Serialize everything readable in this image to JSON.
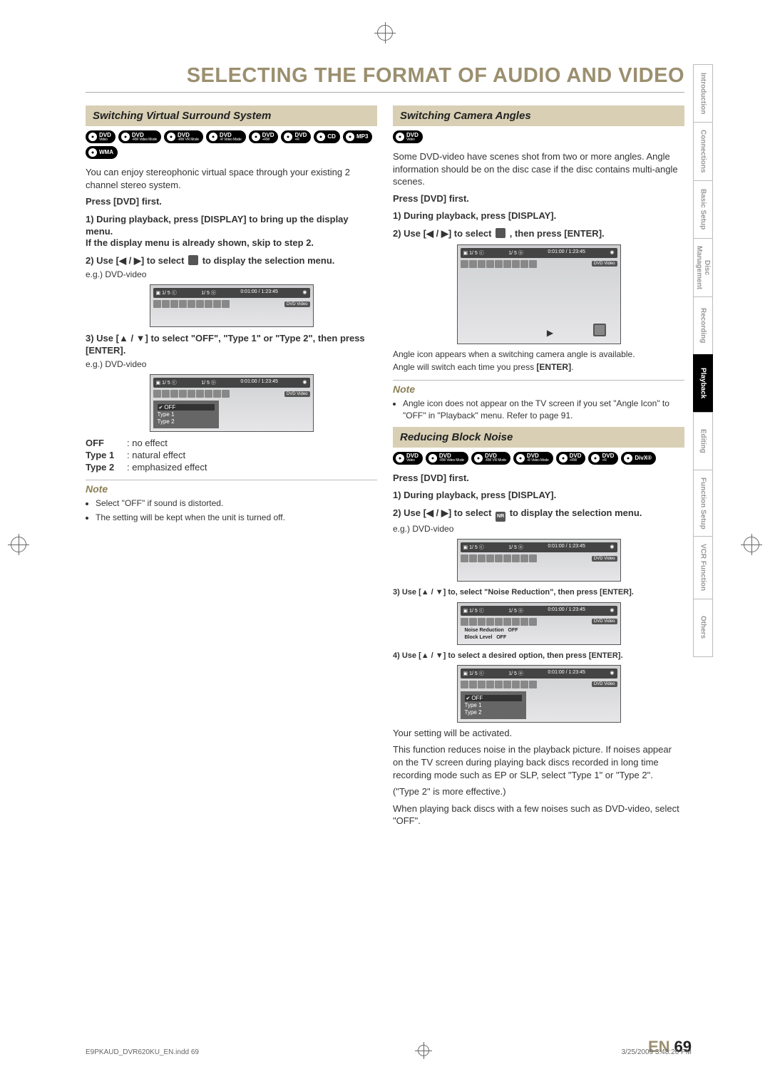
{
  "title": "SELECTING THE FORMAT OF AUDIO AND VIDEO",
  "page_label": "EN",
  "page_number": "69",
  "footer_file": "E9PKAUD_DVR620KU_EN.indd   69",
  "footer_time": "3/25/2009   3:48:26 PM",
  "tabs": [
    "Introduction",
    "Connections",
    "Basic Setup",
    "Disc\nManagement",
    "Recording",
    "Playback",
    "Editing",
    "Function Setup",
    "VCR Function",
    "Others"
  ],
  "active_tab": "Playback",
  "osd_common": {
    "top_left": "1/  5",
    "top_mid": "1/  5",
    "time": "0:01:00 / 1:23:45",
    "badge": "DVD  Video"
  },
  "left": {
    "section": "Switching Virtual Surround System",
    "discs": [
      {
        "t": "DVD",
        "s": "Video"
      },
      {
        "t": "DVD",
        "s": "-RW Video Mode"
      },
      {
        "t": "DVD",
        "s": "-RW VR Mode"
      },
      {
        "t": "DVD",
        "s": "-R Video Mode"
      },
      {
        "t": "DVD",
        "s": "+RW"
      },
      {
        "t": "DVD",
        "s": "+R"
      },
      {
        "t": "CD",
        "s": ""
      },
      {
        "t": "MP3",
        "s": ""
      },
      {
        "t": "WMA",
        "s": ""
      }
    ],
    "intro": "You can enjoy stereophonic virtual space through your existing 2 channel stereo system.",
    "press": "Press [DVD] first.",
    "s1": "1) During playback, press [DISPLAY] to bring up the display menu.",
    "s1b": "If the display menu is already shown, skip to step 2.",
    "s2a": "2) Use [",
    "s2b": " / ",
    "s2c": "] to select ",
    "s2d": " to display the selection menu.",
    "eg": "e.g.) DVD-video",
    "s3": "3) Use [▲ / ▼] to select \"OFF\", \"Type 1\" or \"Type 2\", then press [ENTER].",
    "menu_items": [
      "OFF",
      "Type 1",
      "Type 2"
    ],
    "defs": [
      {
        "k": "OFF",
        "v": ": no effect"
      },
      {
        "k": "Type 1",
        "v": ": natural effect"
      },
      {
        "k": "Type 2",
        "v": ": emphasized effect"
      }
    ],
    "note_title": "Note",
    "notes": [
      "Select \"OFF\" if sound is distorted.",
      "The setting will be kept when the unit is turned off."
    ]
  },
  "right": {
    "sec_angle": "Switching Camera Angles",
    "discs_angle": [
      {
        "t": "DVD",
        "s": "Video"
      }
    ],
    "angle_intro": "Some DVD-video have scenes shot from two or more angles. Angle information should be on the disc case if the disc contains multi-angle scenes.",
    "press": "Press [DVD] first.",
    "a1": "1) During playback, press [DISPLAY].",
    "a2a": "2) Use [",
    "a2b": " / ",
    "a2c": "] to select ",
    "a2d": " , then press [ENTER].",
    "angle_cap1": "Angle icon appears when a switching camera angle is available.",
    "angle_cap2_a": "Angle will switch each time you press ",
    "angle_cap2_b": "[ENTER]",
    "angle_cap2_c": ".",
    "note_title": "Note",
    "angle_notes": [
      "Angle icon does not appear on the TV screen if you set \"Angle Icon\" to \"OFF\" in \"Playback\" menu. Refer to page 91."
    ],
    "sec_noise": "Reducing Block Noise",
    "discs_noise": [
      {
        "t": "DVD",
        "s": "Video"
      },
      {
        "t": "DVD",
        "s": "-RW Video Mode"
      },
      {
        "t": "DVD",
        "s": "-RW VR Mode"
      },
      {
        "t": "DVD",
        "s": "-R Video Mode"
      },
      {
        "t": "DVD",
        "s": "+RW"
      },
      {
        "t": "DVD",
        "s": "+R"
      },
      {
        "t": "DivX®",
        "s": ""
      }
    ],
    "n1": "1) During playback, press [DISPLAY].",
    "n2a": "2) Use [",
    "n2b": " / ",
    "n2c": "] to select ",
    "n2d": " to display the selection menu.",
    "n2icon": "NR",
    "eg": "e.g.) DVD-video",
    "n3": "3) Use [▲ / ▼] to, select \"Noise Reduction\", then press [ENTER].",
    "nr_rows": [
      {
        "k": "Noise Reduction",
        "v": "OFF"
      },
      {
        "k": "Block Level",
        "v": "OFF"
      }
    ],
    "n4": "4) Use [▲ / ▼] to select a desired option, then press [ENTER].",
    "menu_items": [
      "OFF",
      "Type 1",
      "Type 2"
    ],
    "post1": "Your setting will be activated.",
    "post2": "This function reduces noise in the playback picture. If noises appear on the TV screen during playing back discs recorded in long time recording mode such as EP or SLP, select \"Type 1\" or \"Type 2\".",
    "post3": "(\"Type 2\" is more effective.)",
    "post4": "When playing back discs with a few noises such as DVD-video, select \"OFF\"."
  }
}
